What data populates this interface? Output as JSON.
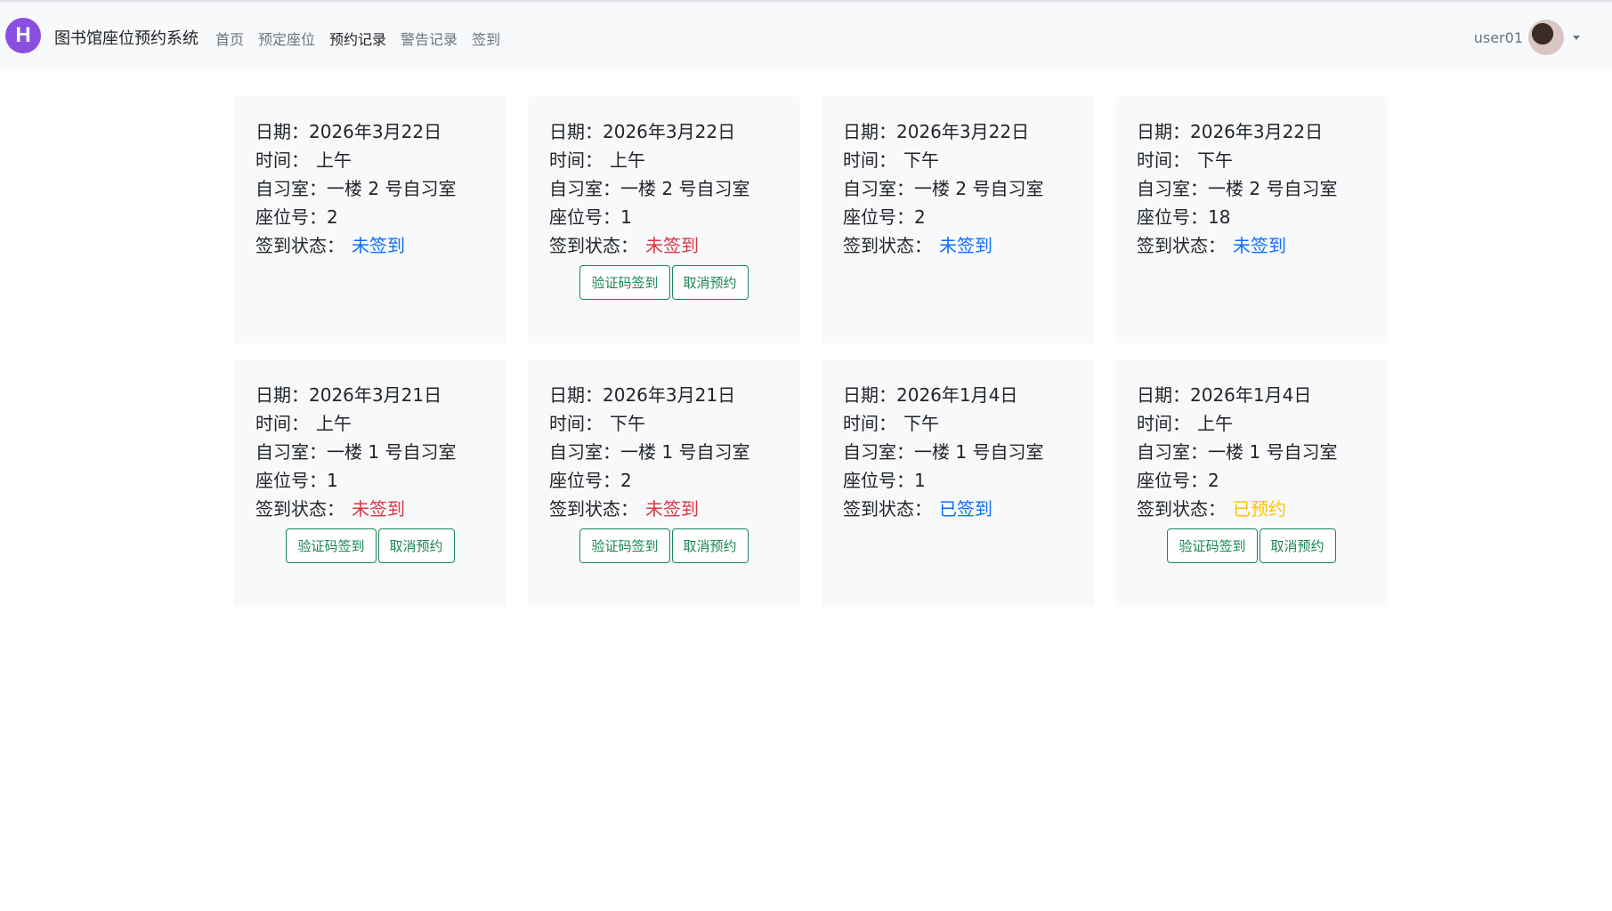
{
  "brand": {
    "logo_letter": "H",
    "title": "图书馆座位预约系统"
  },
  "nav": [
    {
      "label": "首页"
    },
    {
      "label": "预定座位"
    },
    {
      "label": "预约记录"
    },
    {
      "label": "警告记录"
    },
    {
      "label": "签到"
    }
  ],
  "user": {
    "name": "user01"
  },
  "labels": {
    "date": "日期：",
    "time": "时间：",
    "room": "自习室：",
    "seat": "座位号：",
    "status": "签到状态：",
    "checkin_btn": "验证码签到",
    "cancel_btn": "取消预约"
  },
  "colors": {
    "blue": "#0d6efd",
    "red": "#dc3545",
    "yellow": "#ffc107",
    "green": "#198754"
  },
  "records": [
    {
      "date": "2026年3月22日",
      "time": "上午",
      "room": "一楼 2 号自习室",
      "seat": "2",
      "status": "未签到",
      "status_color": "blue",
      "actions": false
    },
    {
      "date": "2026年3月22日",
      "time": "上午",
      "room": "一楼 2 号自习室",
      "seat": "1",
      "status": "未签到",
      "status_color": "red",
      "actions": true
    },
    {
      "date": "2026年3月22日",
      "time": "下午",
      "room": "一楼 2 号自习室",
      "seat": "2",
      "status": "未签到",
      "status_color": "blue",
      "actions": false
    },
    {
      "date": "2026年3月22日",
      "time": "下午",
      "room": "一楼 2 号自习室",
      "seat": "18",
      "status": "未签到",
      "status_color": "blue",
      "actions": false
    },
    {
      "date": "2026年3月21日",
      "time": "上午",
      "room": "一楼 1 号自习室",
      "seat": "1",
      "status": "未签到",
      "status_color": "red",
      "actions": true
    },
    {
      "date": "2026年3月21日",
      "time": "下午",
      "room": "一楼 1 号自习室",
      "seat": "2",
      "status": "未签到",
      "status_color": "red",
      "actions": true
    },
    {
      "date": "2026年1月4日",
      "time": "下午",
      "room": "一楼 1 号自习室",
      "seat": "1",
      "status": "已签到",
      "status_color": "blue",
      "actions": false
    },
    {
      "date": "2026年1月4日",
      "time": "上午",
      "room": "一楼 1 号自习室",
      "seat": "2",
      "status": "已预约",
      "status_color": "yellow",
      "actions": true
    }
  ]
}
